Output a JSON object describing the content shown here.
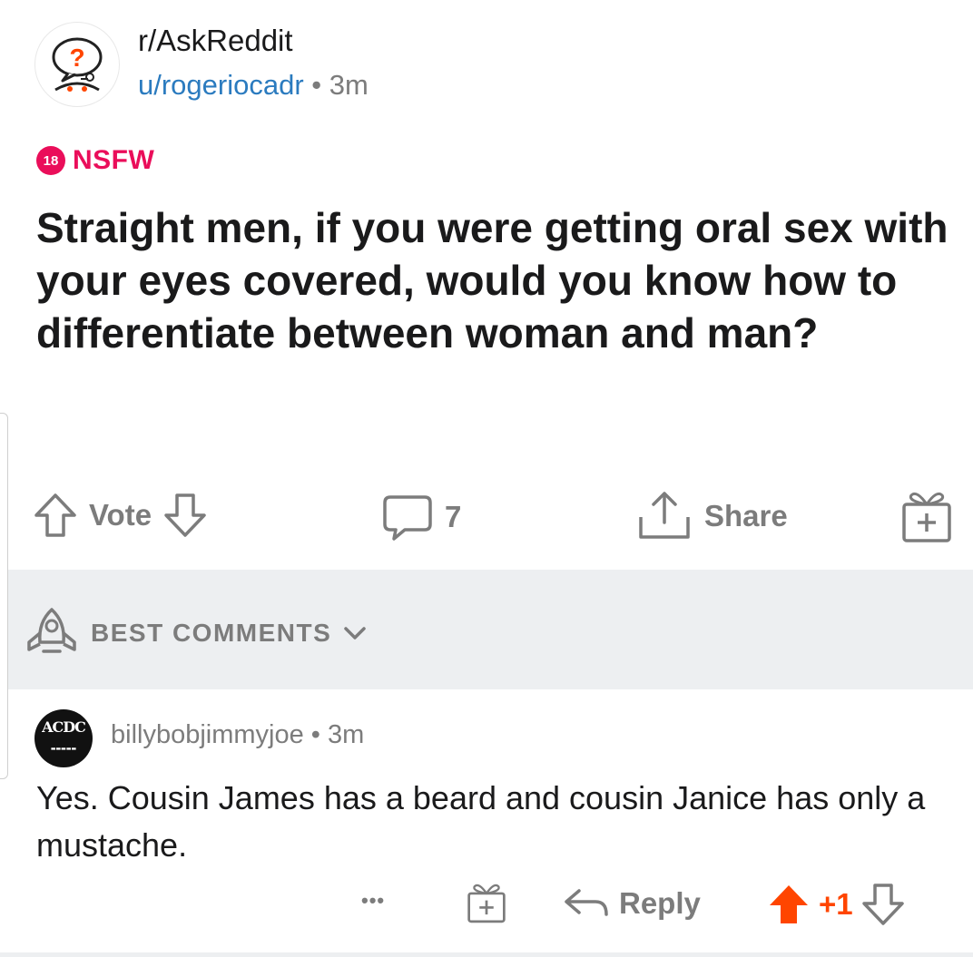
{
  "post": {
    "subreddit": "r/AskReddit",
    "author": "u/rogeriocadr",
    "separator": " • ",
    "age": "3m",
    "nsfw_badge": "18",
    "nsfw_label": "NSFW",
    "title": "Straight men, if you were getting oral sex with your eyes covered, would you know how to differentiate between woman and man?",
    "vote_label": "Vote",
    "comment_count": "7",
    "share_label": "Share"
  },
  "sort": {
    "label": "BEST COMMENTS"
  },
  "comment": {
    "avatar_text": "ACDC",
    "author": "billybobjimmyjoe",
    "separator": " • ",
    "age": "3m",
    "body": "Yes. Cousin James has a beard and cousin Janice has only a mustache.",
    "more_label": "•••",
    "reply_label": "Reply",
    "score": "+1"
  },
  "colors": {
    "nsfw": "#ea0e5a",
    "upvote_active": "#ff4500",
    "link": "#2b7bbf",
    "meta": "#7c7c7c"
  },
  "icons": [
    "askreddit-snoo-icon",
    "upvote-icon",
    "downvote-icon",
    "comment-icon",
    "share-icon",
    "award-icon",
    "rocket-icon",
    "chevron-down-icon",
    "more-icon",
    "reply-icon",
    "upvote-active-icon"
  ]
}
